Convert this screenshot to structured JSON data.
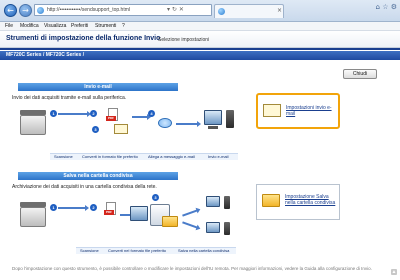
{
  "browser": {
    "address": "http://••••••••••••/sendsupport_top.html",
    "tab_title": "",
    "menu": [
      "File",
      "Modifica",
      "Visualizza",
      "Preferiti",
      "Strumenti",
      "?"
    ]
  },
  "header": {
    "title": "Strumenti di impostazione della funzione Invio",
    "tab": "Selezione impostazioni"
  },
  "breadcrumb": "MF720C Series / MF720C Series /",
  "close_label": "Chiudi",
  "email_section": {
    "title": "Invio e-mail",
    "description": "Invio dei dati acquisiti tramite e-mail sulla periferica.",
    "steps": [
      "Scansione",
      "Converti in formato file preferito",
      "Allega a messaggio e-mail",
      "Invio e-mail"
    ],
    "feature_label": "Impostazioni invio e-mail"
  },
  "folder_section": {
    "title": "Salva nella cartella condivisa",
    "description": "Archiviazione dei dati acquisiti in una cartella condivisa della rete.",
    "steps": [
      "Scansione",
      "Converti nel formato file preferito",
      "Salva nella cartella condivisa"
    ],
    "feature_label": "Impostazione Salva nella cartella condivisa"
  },
  "footer": "Dopo l'impostazione con questo strumento, è possibile controllare o modificare le impostazioni dell'IU remota. Per maggiori informazioni, vedere la Guida alla configurazione di Invio."
}
